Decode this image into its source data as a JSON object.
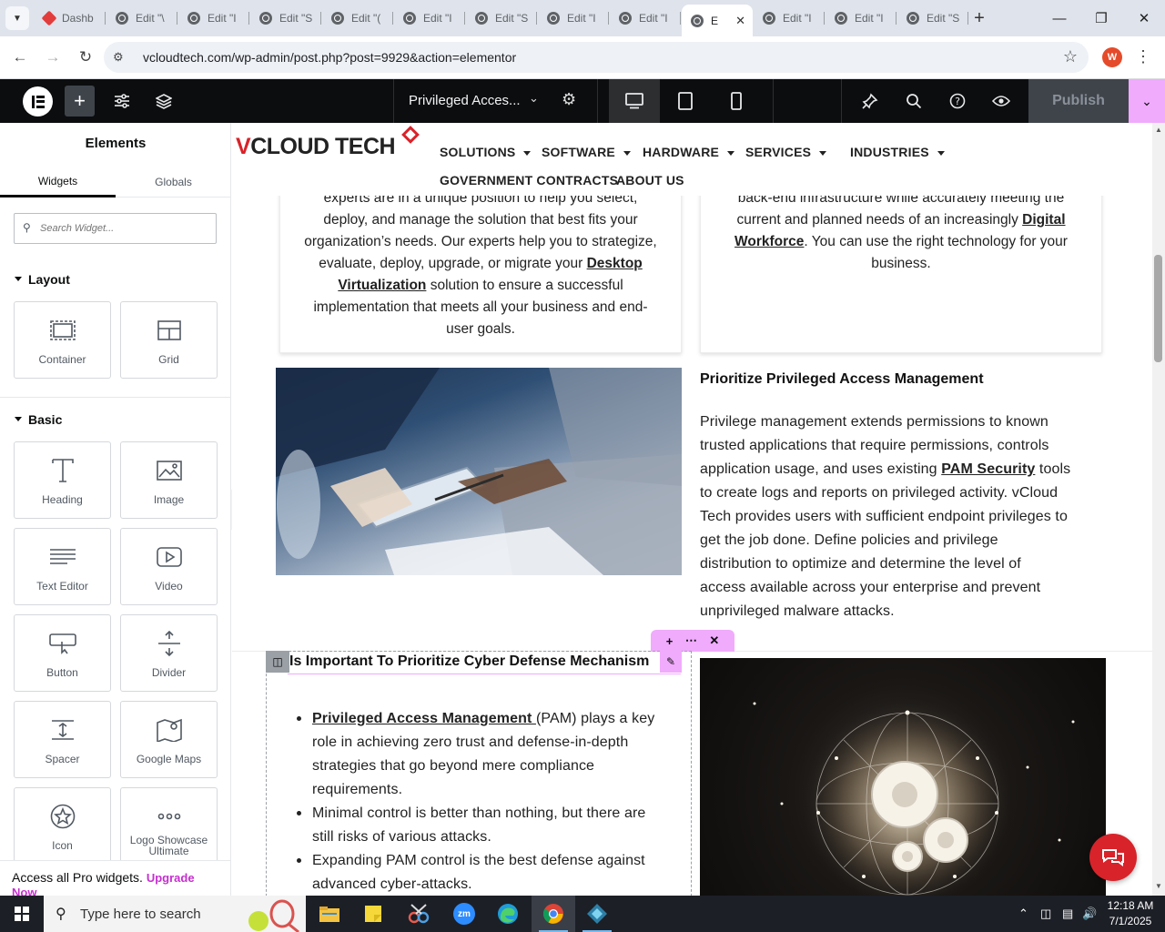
{
  "browser": {
    "tabs": [
      {
        "label": "Dashb",
        "icon": "wordpress-dashboard-icon"
      },
      {
        "label": "Edit \"\\",
        "icon": "wordpress-icon"
      },
      {
        "label": "Edit \"I",
        "icon": "wordpress-icon"
      },
      {
        "label": "Edit \"S",
        "icon": "wordpress-icon"
      },
      {
        "label": "Edit \"(",
        "icon": "wordpress-icon"
      },
      {
        "label": "Edit \"I",
        "icon": "wordpress-icon"
      },
      {
        "label": "Edit \"S",
        "icon": "wordpress-icon"
      },
      {
        "label": "Edit \"I",
        "icon": "wordpress-icon"
      },
      {
        "label": "Edit \"I",
        "icon": "wordpress-icon"
      },
      {
        "label": "E",
        "icon": "wordpress-icon",
        "active": true
      },
      {
        "label": "Edit \"I",
        "icon": "wordpress-icon"
      },
      {
        "label": "Edit \"I",
        "icon": "wordpress-icon"
      },
      {
        "label": "Edit \"S",
        "icon": "wordpress-icon"
      }
    ],
    "url": "vcloudtech.com/wp-admin/post.php?post=9929&action=elementor",
    "profile_initial": "W"
  },
  "elementor": {
    "document_title": "Privileged Acces...",
    "publish_label": "Publish",
    "panel": {
      "title": "Elements",
      "tabs": [
        "Widgets",
        "Globals"
      ],
      "search_placeholder": "Search Widget...",
      "layout_label": "Layout",
      "basic_label": "Basic",
      "layout_widgets": [
        {
          "label": "Container",
          "icon": "container-icon"
        },
        {
          "label": "Grid",
          "icon": "grid-icon"
        }
      ],
      "basic_widgets": [
        {
          "label": "Heading",
          "icon": "heading-icon"
        },
        {
          "label": "Image",
          "icon": "image-icon"
        },
        {
          "label": "Text Editor",
          "icon": "text-editor-icon"
        },
        {
          "label": "Video",
          "icon": "video-icon"
        },
        {
          "label": "Button",
          "icon": "button-icon"
        },
        {
          "label": "Divider",
          "icon": "divider-icon"
        },
        {
          "label": "Spacer",
          "icon": "spacer-icon"
        },
        {
          "label": "Google Maps",
          "icon": "google-maps-icon"
        },
        {
          "label": "Icon",
          "icon": "star-icon"
        },
        {
          "label": "Logo Showcase Ultimate",
          "icon": "logo-showcase-icon"
        }
      ],
      "promo_text": "Access all Pro widgets.",
      "promo_link": "Upgrade Now"
    }
  },
  "site": {
    "logo_v": "V",
    "logo_rest": "CLOUD TECH",
    "nav": [
      {
        "label": "SOLUTIONS",
        "dropdown": true
      },
      {
        "label": "SOFTWARE",
        "dropdown": true
      },
      {
        "label": "HARDWARE",
        "dropdown": true
      },
      {
        "label": "SERVICES",
        "dropdown": true
      },
      {
        "label": "INDUSTRIES",
        "dropdown": true
      },
      {
        "label": "GOVERNMENT CONTRACTS",
        "dropdown": false
      },
      {
        "label": "ABOUT US",
        "dropdown": false
      }
    ],
    "card_left": {
      "l0": "experts are in a unique position to help you select,",
      "l1": "deploy, and manage the solution that best fits your",
      "l2": "organization’s needs. Our experts help you to strategize,",
      "l3a": "evaluate, deploy, upgrade, or migrate your ",
      "l3link": "Desktop",
      "l4link": "Virtualization",
      "l4b": " solution to ensure a successful",
      "l5": "implementation that meets all your business and end-",
      "l6": "user goals."
    },
    "card_right": {
      "l0": "back-end infrastructure while accurately meeting the",
      "l1a": "current and planned needs of an increasingly ",
      "l1link": "Digital",
      "l2link": "Workforce",
      "l2b": ". You can use the right technology for your",
      "l3": "business."
    },
    "section2": {
      "heading": "Prioritize Privileged Access Management",
      "l0": "Privilege management extends permissions to known",
      "l1": "trusted applications that require permissions, controls",
      "l2a": "application usage, and uses existing ",
      "l2link": "PAM Security",
      "l2b": " tools",
      "l3": "to create logs and reports on privileged activity. vCloud",
      "l4": "Tech provides users with sufficient endpoint privileges to",
      "l5": "get the job done. Define policies and privilege",
      "l6": "distribution to optimize and determine the level of",
      "l7": "access available across your enterprise and prevent",
      "l8": "unprivileged malware attacks."
    },
    "section3": {
      "heading": "Is Important To Prioritize Cyber Defense Mechanism",
      "b1link": "Privileged Access Management ",
      "b1l0": "(PAM) plays a key",
      "b1l1": "role in achieving zero trust and defense-in-depth",
      "b1l2": "strategies that go beyond mere compliance",
      "b1l3": "requirements.",
      "b2l0": "Minimal control is better than nothing, but there are",
      "b2l1": "still risks of various attacks.",
      "b3l0": "Expanding PAM control is the best defense against",
      "b3l1": "advanced cyber-attacks."
    }
  },
  "taskbar": {
    "search_placeholder": "Type here to search",
    "time": "12:18 AM",
    "date": "7/1/2025",
    "apps": [
      "file-explorer-icon",
      "sticky-notes-icon",
      "snipping-tool-icon",
      "zoom-icon",
      "edge-icon",
      "chrome-icon",
      "vpn-app-icon"
    ],
    "zoom_label": "zm"
  },
  "colors": {
    "accent_pink": "#f0abfc",
    "brand_red": "#d8232a",
    "elementor_dark": "#0c0d0e",
    "promo_link": "#c62fcf"
  }
}
